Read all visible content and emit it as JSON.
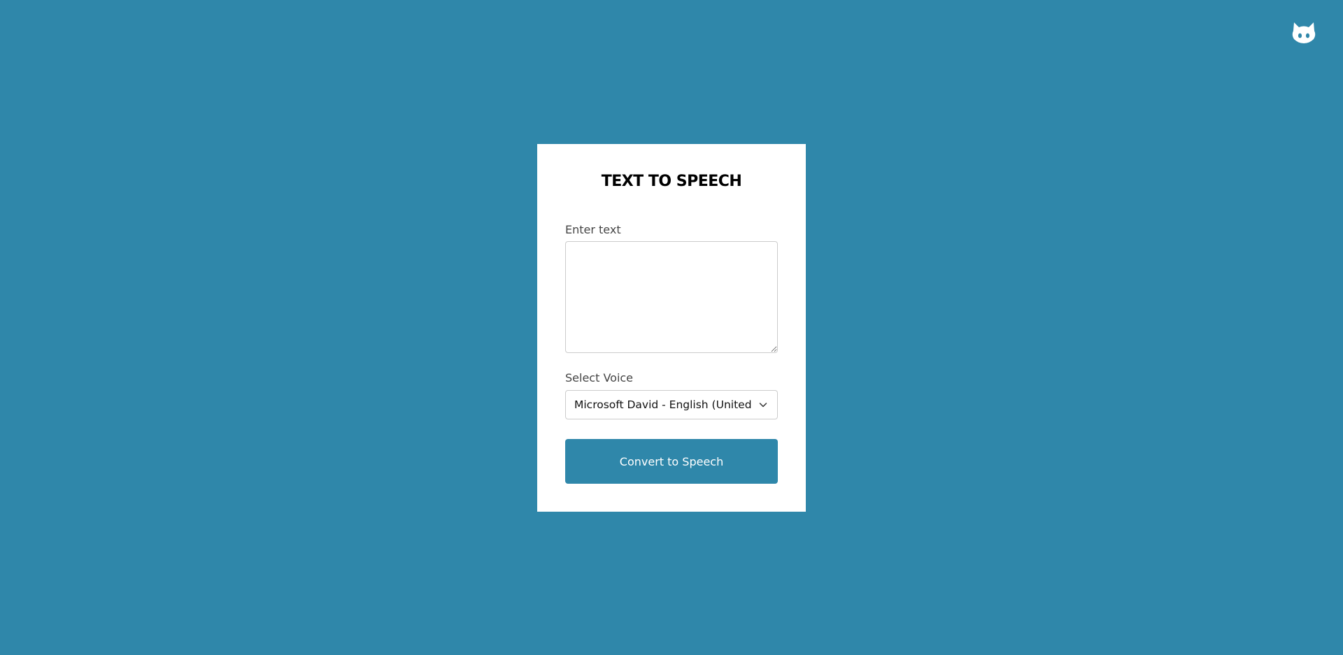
{
  "app": {
    "title": "TEXT TO SPEECH",
    "background_color": "#2f87aa",
    "card_color": "#ffffff"
  },
  "github": {
    "icon": "github-octocat-icon"
  },
  "form": {
    "text_label": "Enter text",
    "text_value": "",
    "voice_label": "Select Voice",
    "voice_selected": "Microsoft David - English (United States)",
    "voice_dropdown_icon": "chevron-down-icon",
    "submit_label": "Convert to Speech",
    "button_color": "#2f87aa"
  }
}
